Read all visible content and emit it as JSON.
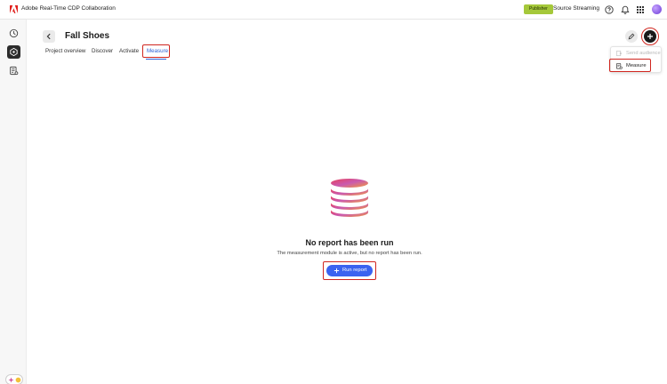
{
  "app": {
    "title": "Adobe Real-Time CDP Collaboration",
    "publisher_badge": "Publisher",
    "source_label": "Source Streaming"
  },
  "header": {
    "title": "Fall Shoes"
  },
  "tabs": [
    {
      "label": "Project overview"
    },
    {
      "label": "Discover"
    },
    {
      "label": "Activate"
    },
    {
      "label": "Measure"
    }
  ],
  "menu": {
    "items": [
      {
        "label": "Send audience",
        "enabled": false
      },
      {
        "label": "Measure",
        "enabled": true
      }
    ]
  },
  "empty_state": {
    "title": "No report has been run",
    "description": "The measurement module is active, but no report has been run.",
    "button_label": "Run report"
  },
  "colors": {
    "accent": "#3b63f0",
    "highlight": "#d0261f",
    "badge": "#a5c83a",
    "brand": "#e0201c"
  },
  "icons": {
    "brand": "adobe-logo-icon",
    "help": "help-icon",
    "bell": "bell-icon",
    "grid": "app-switcher-icon",
    "rail_1": "clock-icon",
    "rail_2": "collaboration-icon",
    "rail_3": "report-icon",
    "empty": "database-icon"
  }
}
